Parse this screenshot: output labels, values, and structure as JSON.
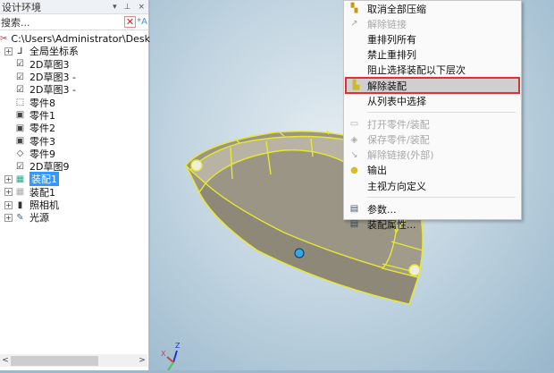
{
  "panel": {
    "title": "设计环境",
    "pin": "▾",
    "dock": "ₓ",
    "close": "×",
    "search_placeholder": "搜索...",
    "clear": "✕",
    "filter": "*A"
  },
  "tree": [
    {
      "label": "C:\\Users\\Administrator\\Desktop\\",
      "icon": "assembly-root-icon",
      "level": 0
    },
    {
      "label": "全局坐标系",
      "icon": "coordinate-system-icon",
      "level": 1,
      "expand": "+"
    },
    {
      "label": "2D草图3",
      "icon": "sketch-icon",
      "level": 1
    },
    {
      "label": "2D草图3 -",
      "icon": "sketch-icon",
      "level": 1
    },
    {
      "label": "2D草图3 -",
      "icon": "sketch-icon",
      "level": 1
    },
    {
      "label": "零件8",
      "icon": "part-box-icon",
      "level": 1
    },
    {
      "label": "零件1",
      "icon": "part-icon",
      "level": 1
    },
    {
      "label": "零件2",
      "icon": "part-icon",
      "level": 1
    },
    {
      "label": "零件3",
      "icon": "part-icon",
      "level": 1
    },
    {
      "label": "零件9",
      "icon": "part-diamond-icon",
      "level": 1
    },
    {
      "label": "2D草图9",
      "icon": "sketch-icon",
      "level": 1
    },
    {
      "label": "装配1",
      "icon": "assembly-icon",
      "level": 1,
      "expand": "+",
      "selected": true
    },
    {
      "label": "装配1",
      "icon": "assembly-gray-icon",
      "level": 1,
      "expand": "+"
    },
    {
      "label": "照相机",
      "icon": "camera-icon",
      "level": 1,
      "expand": "+"
    },
    {
      "label": "光源",
      "icon": "light-icon",
      "level": 1,
      "expand": "+"
    }
  ],
  "menu": [
    {
      "label": "取消全部压缩",
      "icon": "unsuppress-icon",
      "disabled": false
    },
    {
      "label": "解除链接",
      "icon": "unlink-icon",
      "disabled": true
    },
    {
      "label": "重排列所有",
      "disabled": false
    },
    {
      "label": "禁止重排列",
      "disabled": false
    },
    {
      "label": "阻止选择装配以下层次",
      "disabled": false
    },
    {
      "label": "解除装配",
      "icon": "disassemble-icon",
      "disabled": false,
      "highlighted": true
    },
    {
      "label": "从列表中选择",
      "disabled": false
    },
    {
      "sep": true
    },
    {
      "label": "打开零件/装配",
      "icon": "open-folder-icon",
      "disabled": true
    },
    {
      "label": "保存零件/装配",
      "icon": "save-icon",
      "disabled": true
    },
    {
      "label": "解除链接(外部)",
      "icon": "unlink-external-icon",
      "disabled": true
    },
    {
      "label": "输出",
      "icon": "export-icon",
      "disabled": false
    },
    {
      "label": "主视方向定义",
      "disabled": false
    },
    {
      "sep": true
    },
    {
      "label": "参数...",
      "icon": "parameters-icon",
      "disabled": false
    },
    {
      "label": "装配属性...",
      "icon": "properties-icon",
      "disabled": false
    }
  ],
  "axes": {
    "x": "X",
    "y": "Y",
    "z": "Z"
  }
}
